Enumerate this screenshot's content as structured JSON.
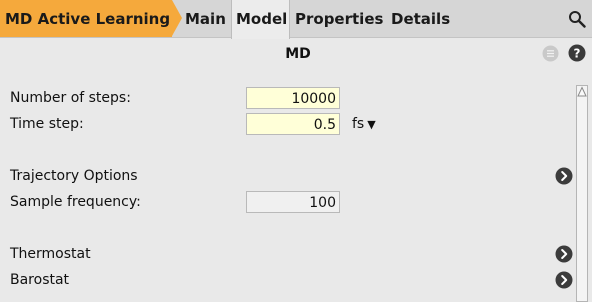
{
  "tabbar": {
    "breadcrumb": "MD Active Learning",
    "tabs": [
      {
        "label": "Main"
      },
      {
        "label": "Model"
      },
      {
        "label": "Properties"
      },
      {
        "label": "Details"
      }
    ],
    "active_tab": "Model"
  },
  "panel": {
    "title": "MD",
    "fields": {
      "num_steps": {
        "label": "Number of steps:",
        "value": "10000"
      },
      "time_step": {
        "label": "Time step:",
        "value": "0.5",
        "unit": "fs"
      },
      "sample_frequency": {
        "label": "Sample frequency:",
        "value": "100"
      }
    },
    "sections": {
      "trajectory": "Trajectory Options",
      "thermostat": "Thermostat",
      "barostat": "Barostat"
    }
  },
  "colors": {
    "breadcrumb_bg": "#f5a93c",
    "input_bg": "#ffffd8",
    "tabbar_bg": "#d6d6d6",
    "panel_bg": "#e9e9e9",
    "chevron": "#3c3c3c"
  }
}
